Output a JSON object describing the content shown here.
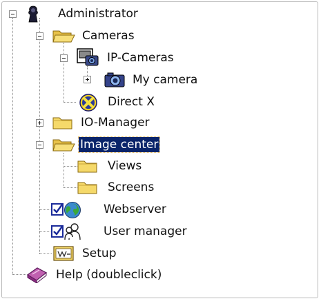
{
  "tree": {
    "admin": {
      "label": "Administrator"
    },
    "cameras": {
      "label": "Cameras"
    },
    "ip_cameras": {
      "label": "IP-Cameras"
    },
    "my_camera": {
      "label": "My camera"
    },
    "direct_x": {
      "label": "Direct X"
    },
    "io_manager": {
      "label": "IO-Manager"
    },
    "image_center": {
      "label": "Image center",
      "selected": true
    },
    "views": {
      "label": "Views"
    },
    "screens": {
      "label": "Screens"
    },
    "webserver": {
      "label": "Webserver",
      "checked": true
    },
    "user_manager": {
      "label": "User manager",
      "checked": true
    },
    "setup": {
      "label": "Setup"
    },
    "help": {
      "label": "Help (doubleclick)"
    }
  },
  "colors": {
    "selection_bg": "#0a246a",
    "selection_text": "#ffffff",
    "folder_fill": "#f5d96a",
    "folder_stroke": "#8a6a10"
  },
  "icons": {
    "admin": "admin-user-icon",
    "folder": "folder-icon",
    "folder_open": "open-folder-icon",
    "ip_cameras": "ip-cameras-icon",
    "camera": "camera-icon",
    "direct_x": "directx-icon",
    "webserver": "globe-icon",
    "user_manager": "user-manager-icon",
    "setup": "setup-icon",
    "help": "help-book-icon",
    "checkbox": "checkbox-checked-icon"
  }
}
